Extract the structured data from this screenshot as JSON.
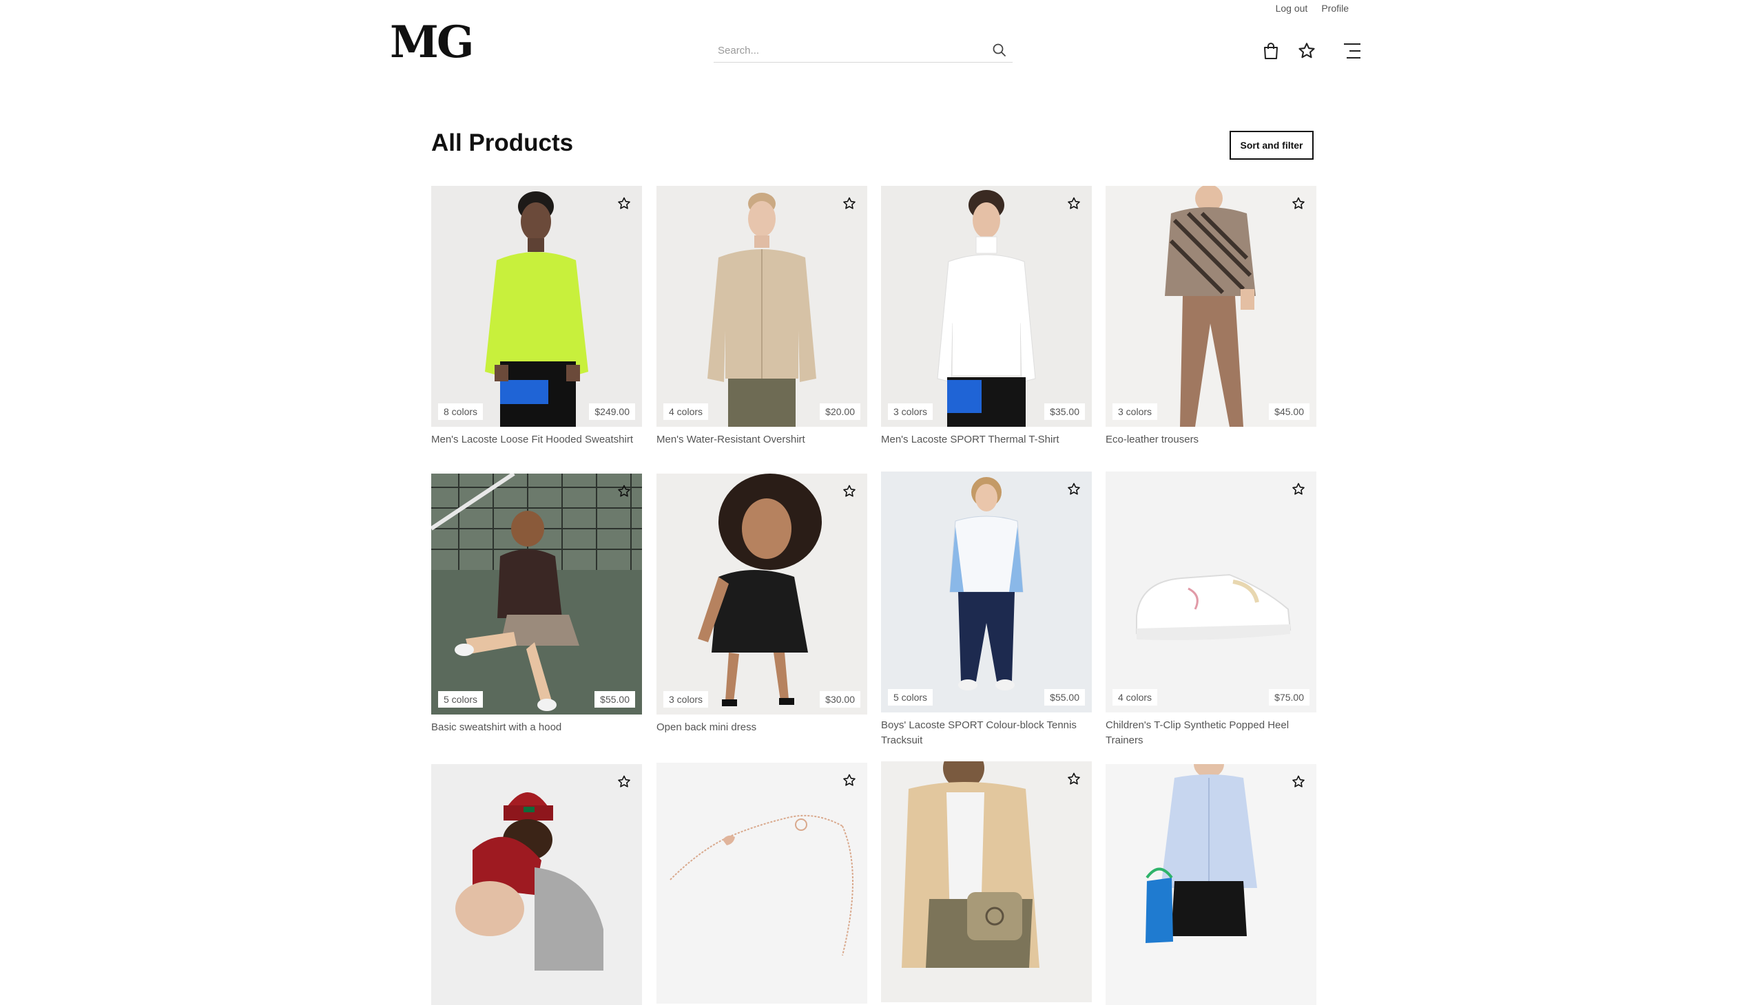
{
  "topbar": {
    "logout": "Log out",
    "profile": "Profile"
  },
  "logo": "MG",
  "search": {
    "placeholder": "Search..."
  },
  "page": {
    "title": "All Products",
    "sort_filter": "Sort and filter"
  },
  "products": [
    {
      "colors": "8 colors",
      "price": "$249.00",
      "name": "Men's Lacoste Loose Fit Hooded Sweatshirt"
    },
    {
      "colors": "4 colors",
      "price": "$20.00",
      "name": "Men's Water-Resistant Overshirt"
    },
    {
      "colors": "3 colors",
      "price": "$35.00",
      "name": "Men's Lacoste SPORT Thermal T-Shirt"
    },
    {
      "colors": "3 colors",
      "price": "$45.00",
      "name": "Eco-leather trousers"
    },
    {
      "colors": "5 colors",
      "price": "$55.00",
      "name": "Basic sweatshirt with a hood"
    },
    {
      "colors": "3 colors",
      "price": "$30.00",
      "name": "Open back mini dress"
    },
    {
      "colors": "5 colors",
      "price": "$55.00",
      "name": "Boys' Lacoste SPORT Colour-block Tennis Tracksuit"
    },
    {
      "colors": "4 colors",
      "price": "$75.00",
      "name": "Children's T-Clip Synthetic Popped Heel Trainers"
    },
    {
      "colors": "",
      "price": "",
      "name": ""
    },
    {
      "colors": "",
      "price": "",
      "name": ""
    },
    {
      "colors": "",
      "price": "",
      "name": ""
    },
    {
      "colors": "",
      "price": "",
      "name": ""
    }
  ],
  "icons": {
    "search": "search-icon",
    "bag": "shopping-bag-icon",
    "star": "star-icon",
    "menu": "menu-icon",
    "favorite": "star-outline-icon"
  }
}
